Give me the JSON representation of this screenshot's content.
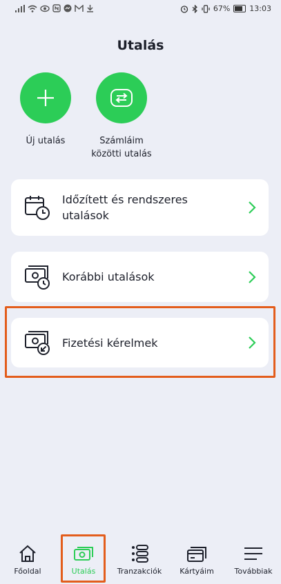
{
  "status_bar": {
    "battery": "67%",
    "time": "13:03",
    "battery_level": 0.67
  },
  "page": {
    "title": "Utalás"
  },
  "actions": [
    {
      "label": "Új utalás",
      "icon": "plus-icon"
    },
    {
      "label": "Számláim\nközötti utalás",
      "label_line1": "Számláim",
      "label_line2": "közötti utalás",
      "icon": "transfer-arrows-icon"
    }
  ],
  "cards": [
    {
      "label_line1": "Időzített és rendszeres",
      "label_line2": "utalások",
      "icon": "calendar-clock-icon"
    },
    {
      "label": "Korábbi utalások",
      "icon": "money-history-icon"
    },
    {
      "label": "Fizetési kérelmek",
      "icon": "money-request-icon"
    }
  ],
  "nav": [
    {
      "label": "Főoldal",
      "icon": "home-icon"
    },
    {
      "label": "Utalás",
      "icon": "money-icon",
      "active": true
    },
    {
      "label": "Tranzakciók",
      "icon": "list-icon"
    },
    {
      "label": "Kártyáim",
      "icon": "cards-icon"
    },
    {
      "label": "Továbbiak",
      "icon": "menu-icon"
    }
  ],
  "colors": {
    "accent": "#2ccd57",
    "highlight": "#e35d1c",
    "background": "#eceef6",
    "text": "#1c1f2a"
  }
}
